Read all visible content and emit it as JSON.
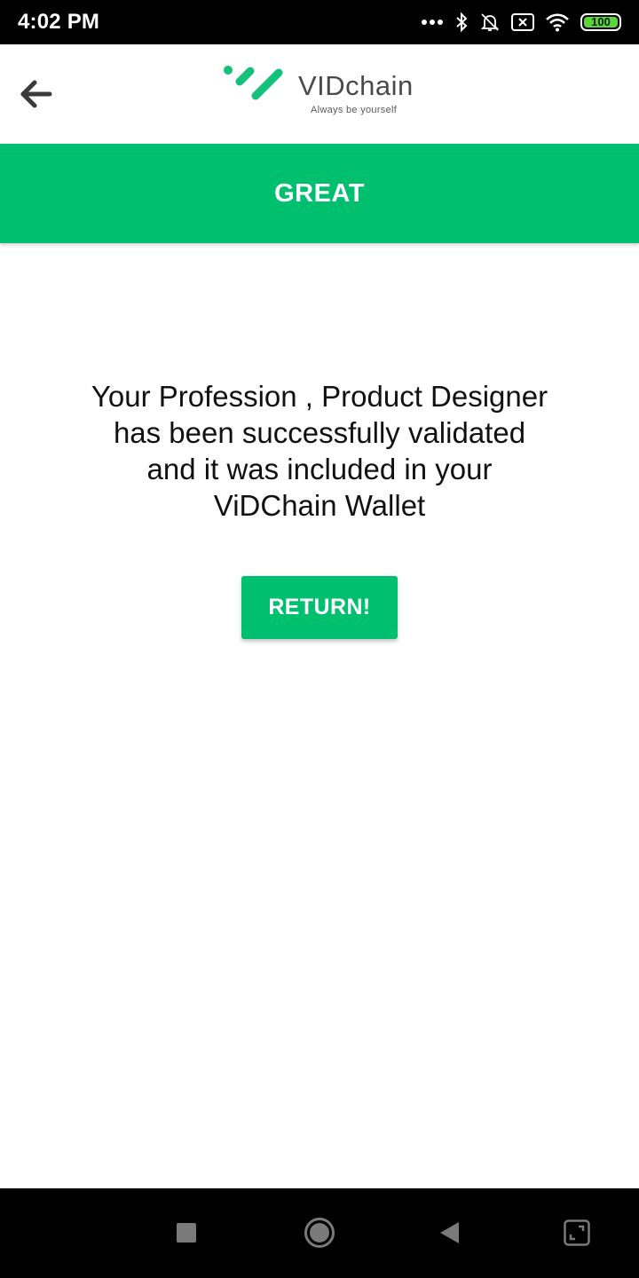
{
  "status_bar": {
    "time": "4:02 PM",
    "battery": "100",
    "icons": [
      "more-dots-icon",
      "bluetooth-icon",
      "bell-muted-icon",
      "sim-off-icon",
      "wifi-icon",
      "battery-icon"
    ]
  },
  "header": {
    "logo_text": "VIDchain",
    "logo_tagline": "Always be yourself",
    "brand_color": "#00c06f"
  },
  "banner": {
    "title": "GREAT"
  },
  "main": {
    "message": "Your Profession , Product Designer has been successfully validated and it was included in your ViDChain Wallet",
    "return_label": "RETURN!"
  },
  "nav_bar": {
    "icons": [
      "recents-square-icon",
      "home-circle-icon",
      "back-triangle-icon",
      "screenshot-icon"
    ]
  }
}
